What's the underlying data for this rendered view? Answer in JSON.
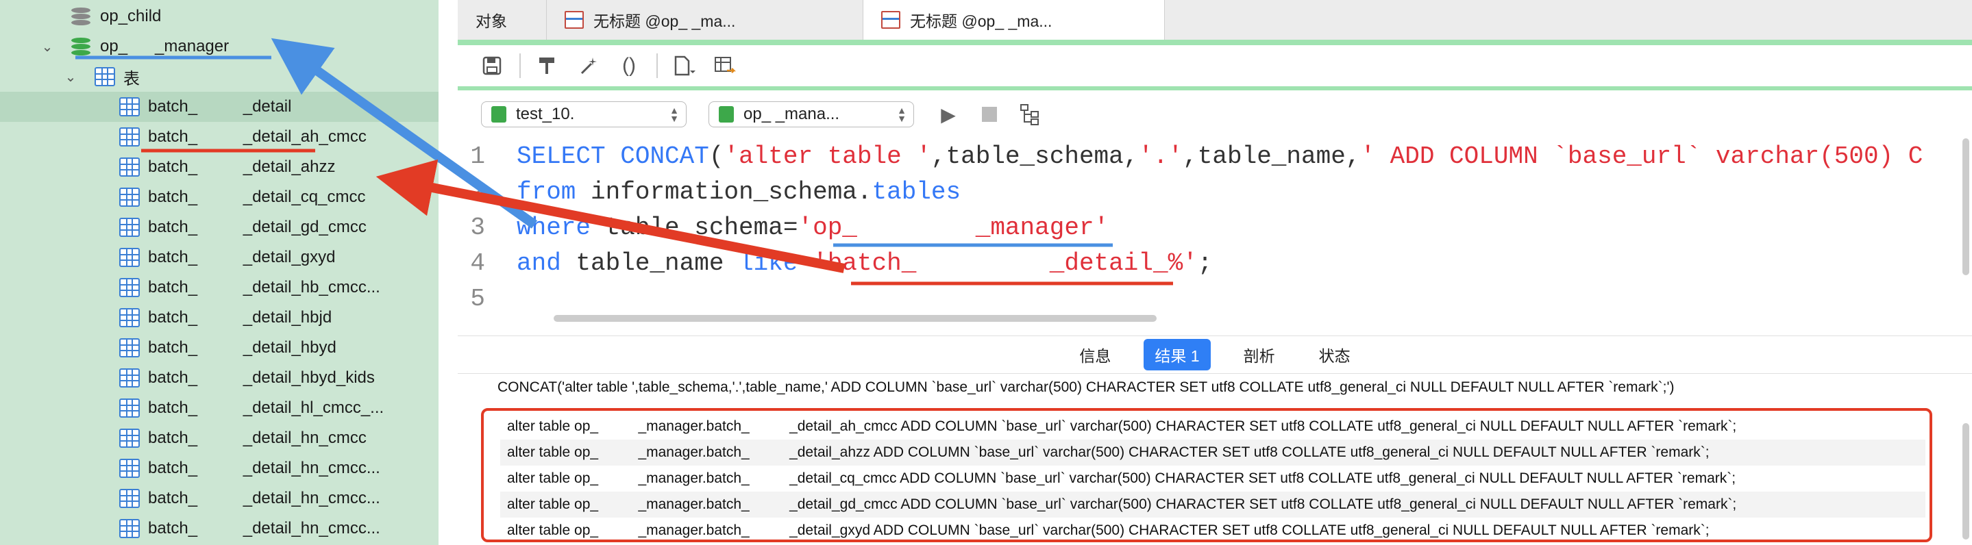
{
  "sidebar": {
    "items": [
      {
        "label": "op_child",
        "kind": "db"
      },
      {
        "label": "op_      _manager",
        "kind": "db-open"
      },
      {
        "label": "表",
        "kind": "folder"
      },
      {
        "label": "batch_          _detail",
        "kind": "table"
      },
      {
        "label": "batch_          _detail_ah_cmcc",
        "kind": "table"
      },
      {
        "label": "batch_          _detail_ahzz",
        "kind": "table"
      },
      {
        "label": "batch_          _detail_cq_cmcc",
        "kind": "table"
      },
      {
        "label": "batch_          _detail_gd_cmcc",
        "kind": "table"
      },
      {
        "label": "batch_          _detail_gxyd",
        "kind": "table"
      },
      {
        "label": "batch_          _detail_hb_cmcc...",
        "kind": "table"
      },
      {
        "label": "batch_          _detail_hbjd",
        "kind": "table"
      },
      {
        "label": "batch_          _detail_hbyd",
        "kind": "table"
      },
      {
        "label": "batch_          _detail_hbyd_kids",
        "kind": "table"
      },
      {
        "label": "batch_          _detail_hl_cmcc_...",
        "kind": "table"
      },
      {
        "label": "batch_          _detail_hn_cmcc",
        "kind": "table"
      },
      {
        "label": "batch_          _detail_hn_cmcc...",
        "kind": "table"
      },
      {
        "label": "batch_          _detail_hn_cmcc...",
        "kind": "table"
      },
      {
        "label": "batch_          _detail_hn_cmcc...",
        "kind": "table"
      }
    ]
  },
  "tabs": [
    {
      "label": "对象"
    },
    {
      "label": "无标题 @op_          _ma..."
    },
    {
      "label": "无标题 @op_          _ma..."
    }
  ],
  "toolbar": {
    "icons": [
      "save-icon",
      "format-icon",
      "magic-wand-icon",
      "parentheses-icon",
      "document-icon",
      "table-export-icon"
    ]
  },
  "connbar": {
    "connection": "test_10.",
    "database": "op_          _mana..."
  },
  "editor": {
    "lines": [
      {
        "n": "1",
        "tokens": [
          {
            "t": "SELECT ",
            "c": "kw"
          },
          {
            "t": "CONCAT",
            "c": "kw"
          },
          {
            "t": "(",
            "c": "plain"
          },
          {
            "t": "'alter table '",
            "c": "str"
          },
          {
            "t": ",table_schema,",
            "c": "plain"
          },
          {
            "t": "'.'",
            "c": "str"
          },
          {
            "t": ",table_name,",
            "c": "plain"
          },
          {
            "t": "' ADD COLUMN `base_url` varchar(500) C",
            "c": "str"
          }
        ]
      },
      {
        "n": "2",
        "tokens": [
          {
            "t": "from ",
            "c": "kw"
          },
          {
            "t": "information_schema.",
            "c": "plain"
          },
          {
            "t": "tables",
            "c": "kw"
          }
        ]
      },
      {
        "n": "3",
        "tokens": [
          {
            "t": "where ",
            "c": "kw"
          },
          {
            "t": "table_schema=",
            "c": "plain"
          },
          {
            "t": "'op_        _manager'",
            "c": "str"
          }
        ]
      },
      {
        "n": "4",
        "tokens": [
          {
            "t": "and ",
            "c": "kw"
          },
          {
            "t": "table_name ",
            "c": "plain"
          },
          {
            "t": "like ",
            "c": "kw"
          },
          {
            "t": "'batch_         _detail_%'",
            "c": "str"
          },
          {
            "t": ";",
            "c": "plain"
          }
        ]
      },
      {
        "n": "5",
        "tokens": []
      }
    ]
  },
  "result_tabs": [
    {
      "label": "信息",
      "active": false
    },
    {
      "label": "结果 1",
      "active": true
    },
    {
      "label": "剖析",
      "active": false
    },
    {
      "label": "状态",
      "active": false
    }
  ],
  "results": {
    "header": "CONCAT('alter table ',table_schema,'.',table_name,' ADD COLUMN `base_url` varchar(500) CHARACTER SET utf8 COLLATE utf8_general_ci NULL DEFAULT NULL AFTER `remark`;')",
    "rows": [
      "alter table op_          _manager.batch_          _detail_ah_cmcc ADD COLUMN `base_url` varchar(500) CHARACTER SET utf8 COLLATE utf8_general_ci NULL DEFAULT NULL AFTER `remark`;",
      "alter table op_          _manager.batch_          _detail_ahzz ADD COLUMN `base_url` varchar(500) CHARACTER SET utf8 COLLATE utf8_general_ci NULL DEFAULT NULL AFTER `remark`;",
      "alter table op_          _manager.batch_          _detail_cq_cmcc ADD COLUMN `base_url` varchar(500) CHARACTER SET utf8 COLLATE utf8_general_ci NULL DEFAULT NULL AFTER `remark`;",
      "alter table op_          _manager.batch_          _detail_gd_cmcc ADD COLUMN `base_url` varchar(500) CHARACTER SET utf8 COLLATE utf8_general_ci NULL DEFAULT NULL AFTER `remark`;",
      "alter table op_          _manager.batch_          _detail_gxyd ADD COLUMN `base_url` varchar(500) CHARACTER SET utf8 COLLATE utf8_general_ci NULL DEFAULT NULL AFTER `remark`;"
    ]
  },
  "colors": {
    "sidebar_bg": "#cce6d3",
    "keyword": "#3478f6",
    "string": "#e0303a",
    "accent_green": "#9fe3b0",
    "annotation_red": "#e23b25",
    "annotation_blue": "#4a90e2"
  }
}
